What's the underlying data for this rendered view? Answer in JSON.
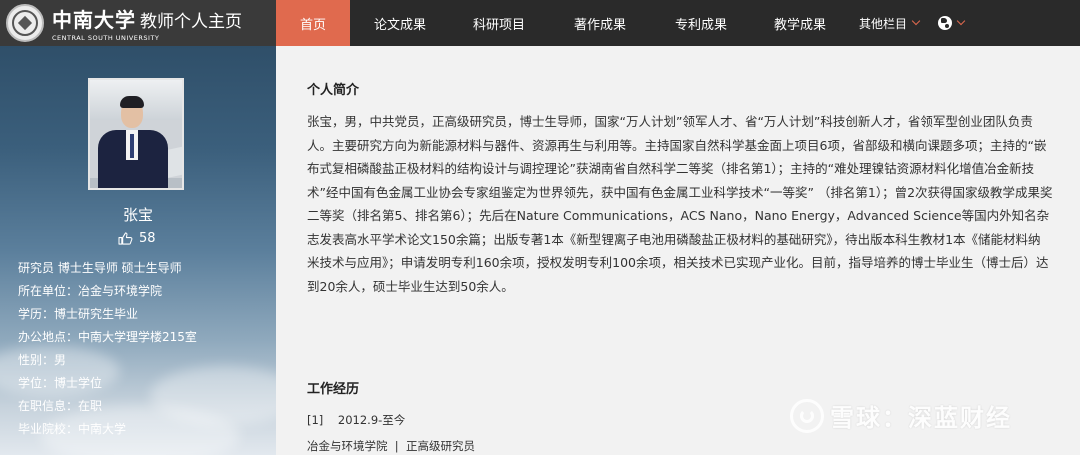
{
  "header": {
    "logo_cn": "中南大学",
    "logo_sub": "教师个人主页",
    "logo_en": "CENTRAL SOUTH UNIVERSITY"
  },
  "nav": {
    "items": [
      "首页",
      "论文成果",
      "科研项目",
      "著作成果",
      "专利成果",
      "教学成果",
      "其他栏目"
    ],
    "active_index": 0
  },
  "profile": {
    "name": "张宝",
    "likes": "58",
    "info": [
      "研究员 博士生导师 硕士生导师",
      "所在单位：冶金与环境学院",
      "学历：博士研究生毕业",
      "办公地点：中南大学理学楼215室",
      "性别：男",
      "学位：博士学位",
      "在职信息：在职",
      "毕业院校：中南大学"
    ]
  },
  "main": {
    "intro_title": "个人简介",
    "bio": "张宝，男，中共党员，正高级研究员，博士生导师，国家“万人计划”领军人才、省“万人计划”科技创新人才，省领军型创业团队负责人。主要研究方向为新能源材料与器件、资源再生与利用等。主持国家自然科学基金面上项目6项，省部级和横向课题多项；主持的“嵌布式复相磷酸盐正极材料的结构设计与调控理论”获湖南省自然科学二等奖（排名第1）；主持的“难处理镍钴资源材料化增值冶金新技术”经中国有色金属工业协会专家组鉴定为世界领先，获中国有色金属工业科学技术“一等奖” （排名第1）；曾2次获得国家级教学成果奖二等奖（排名第5、排名第6）；先后在Nature Communications，ACS Nano，Nano Energy，Advanced Science等国内外知名杂志发表高水平学术论文150余篇；出版专著1本《新型锂离子电池用磷酸盐正极材料的基础研究》，待出版本科生教材1本《储能材料纳米技术与应用》；申请发明专利160余项，授权发明专利100余项，相关技术已实现产业化。目前，指导培养的博士毕业生（博士后）达到20余人，硕士毕业生达到50余人。",
    "work_title": "工作经历",
    "work_entry": "[1]    2012.9-至今",
    "work_detail": "冶金与环境学院  |  正高级研究员"
  },
  "watermark": {
    "text": "雪球：深蓝财经"
  },
  "colors": {
    "accent": "#e06a4e",
    "topbar": "#2a2a2a"
  }
}
